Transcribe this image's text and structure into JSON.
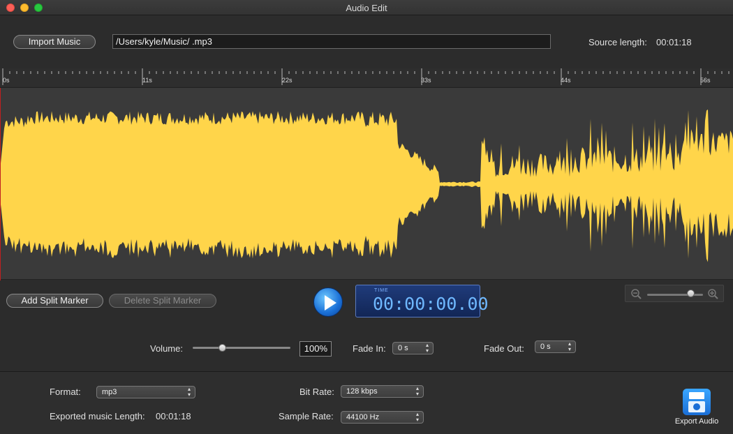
{
  "window": {
    "title": "Audio Edit"
  },
  "header": {
    "import_label": "Import Music",
    "path_value": "/Users/kyle/Music/ .mp3",
    "source_length_label": "Source length:",
    "source_length_value": "00:01:18"
  },
  "ruler": {
    "ticks": [
      "0s",
      "11s",
      "22s",
      "33s",
      "44s",
      "56s"
    ]
  },
  "waveform": {
    "color": "#ffd54a"
  },
  "controls": {
    "add_split_label": "Add Split Marker",
    "delete_split_label": "Delete Split Marker",
    "play_icon": "play-icon",
    "timer_caption": "TIME",
    "timer_value": "00:00:00.00",
    "zoom_level": 0.78
  },
  "mix": {
    "volume_label": "Volume:",
    "volume_value": "100%",
    "volume_level": 0.3,
    "fade_in_label": "Fade In:",
    "fade_in_value": "0 s",
    "fade_out_label": "Fade Out:",
    "fade_out_value": "0 s"
  },
  "export": {
    "format_label": "Format:",
    "format_value": "mp3",
    "bitrate_label": "Bit Rate:",
    "bitrate_value": "128 kbps",
    "samplerate_label": "Sample Rate:",
    "samplerate_value": "44100 Hz",
    "exported_length_label": "Exported music Length:",
    "exported_length_value": "00:01:18",
    "export_button_label": "Export Audio"
  }
}
